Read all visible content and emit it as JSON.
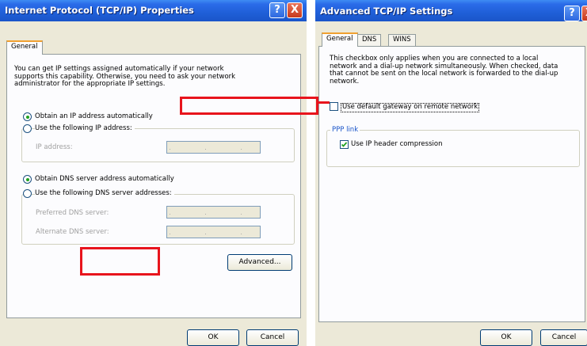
{
  "left_dialog": {
    "title": "Internet Protocol (TCP/IP) Properties",
    "help_label": "?",
    "close_label": "X",
    "tab_general": "General",
    "intro": "You can get IP settings assigned automatically if your network supports this capability. Otherwise, you need to ask your network administrator for the appropriate IP settings.",
    "radio_obtain_ip": "Obtain an IP address automatically",
    "radio_use_ip": "Use the following IP address:",
    "ip_address_label": "IP address:",
    "radio_obtain_dns": "Obtain DNS server address automatically",
    "radio_use_dns": "Use the following DNS server addresses:",
    "preferred_dns_label": "Preferred DNS server:",
    "alternate_dns_label": "Alternate DNS server:",
    "ip_placeholder_dots": ". . .",
    "advanced_button": "Advanced...",
    "ok_button": "OK",
    "cancel_button": "Cancel"
  },
  "right_dialog": {
    "title": "Advanced TCP/IP Settings",
    "help_label": "?",
    "close_label": "X",
    "tabs": [
      "General",
      "DNS",
      "WINS"
    ],
    "description": "This checkbox only applies when you are connected to a local network and a dial-up network simultaneously.  When checked, data that cannot be sent on the local network is forwarded to the dial-up network.",
    "checkbox_default_gateway": "Use default gateway on remote network",
    "checkbox_default_gateway_checked": false,
    "ppp_link_label": "PPP link",
    "checkbox_ip_header": "Use IP header compression",
    "checkbox_ip_header_checked": true,
    "ok_button": "OK",
    "cancel_button": "Cancel"
  },
  "annotation_color": "#e8141c"
}
